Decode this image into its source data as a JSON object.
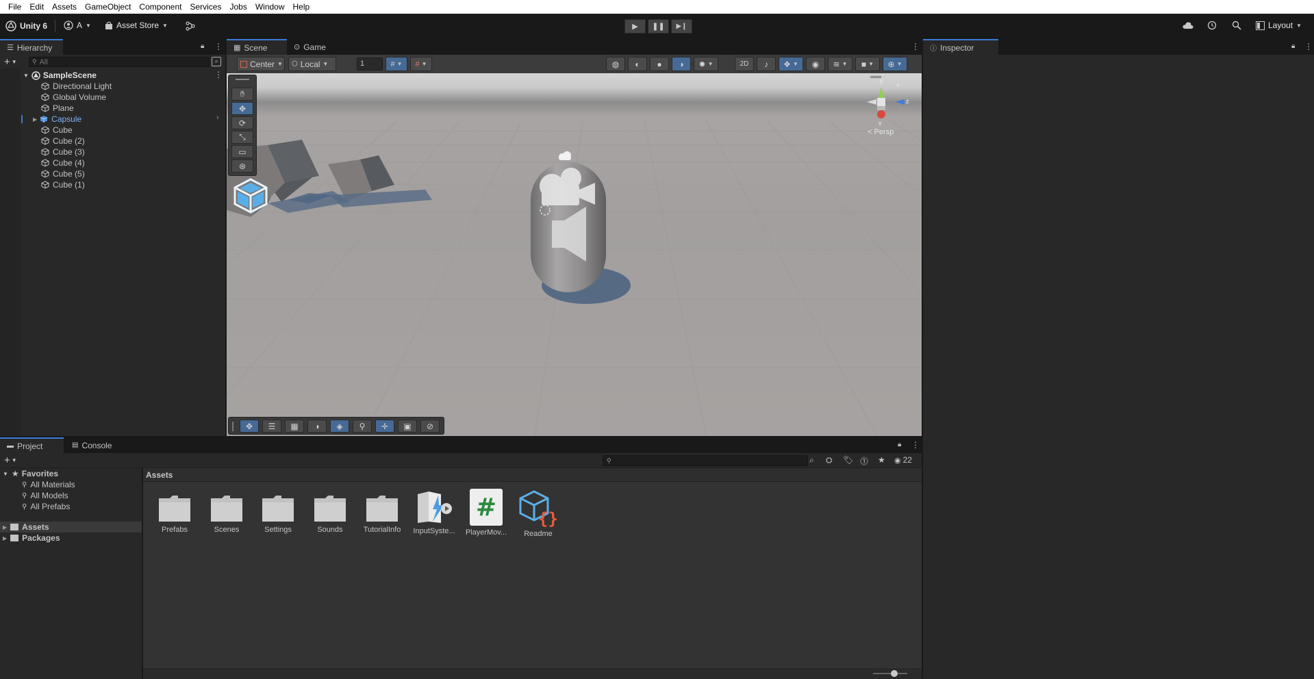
{
  "menu": [
    "File",
    "Edit",
    "Assets",
    "GameObject",
    "Component",
    "Services",
    "Jobs",
    "Window",
    "Help"
  ],
  "toolbar": {
    "app_title": "Unity 6",
    "account_initial": "A",
    "asset_store": "Asset Store",
    "layout": "Layout"
  },
  "hierarchy": {
    "tab": "Hierarchy",
    "search_placeholder": "All",
    "scene": "SampleScene",
    "items": [
      "Directional Light",
      "Global Volume",
      "Plane",
      "Capsule",
      "Cube",
      "Cube (2)",
      "Cube (3)",
      "Cube (4)",
      "Cube (5)",
      "Cube (1)"
    ]
  },
  "scene": {
    "tabs": [
      "Scene",
      "Game"
    ],
    "pivot": "Center",
    "space": "Local",
    "grid_snap": "1",
    "persp": "< Persp",
    "gizmo_y": "y",
    "gizmo_z": "z",
    "gizmo_x": "x"
  },
  "inspector": {
    "tab": "Inspector"
  },
  "project": {
    "tabs": [
      "Project",
      "Console"
    ],
    "visible_count": "22",
    "favorites": "Favorites",
    "favorites_items": [
      "All Materials",
      "All Models",
      "All Prefabs"
    ],
    "roots": [
      "Assets",
      "Packages"
    ],
    "breadcrumb": "Assets",
    "assets": [
      "Prefabs",
      "Scenes",
      "Settings",
      "Sounds",
      "TutorialInfo",
      "InputSyste...",
      "PlayerMov...",
      "Readme"
    ]
  },
  "colors": {
    "accent": "#3a7bd5",
    "selected_text": "#7fb2f0",
    "menu_bg": "#ffffff"
  }
}
